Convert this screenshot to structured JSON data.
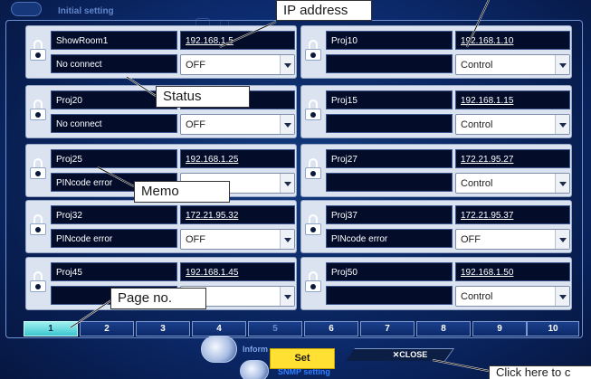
{
  "window": {
    "title": "Initial setting"
  },
  "projectors": [
    {
      "name": "ShowRoom1",
      "ip": "192.168.1.5",
      "status": "No connect",
      "mode": "OFF"
    },
    {
      "name": "Proj10",
      "ip": "192.168.1.10",
      "status": "",
      "mode": "Control"
    },
    {
      "name": "Proj20",
      "ip": "",
      "status": "No connect",
      "mode": "OFF"
    },
    {
      "name": "Proj15",
      "ip": "192.168.1.15",
      "status": "",
      "mode": "Control"
    },
    {
      "name": "Proj25",
      "ip": "192.168.1.25",
      "status": "PINcode error",
      "mode": ""
    },
    {
      "name": "Proj27",
      "ip": "172.21.95.27",
      "status": "",
      "mode": "Control"
    },
    {
      "name": "Proj32",
      "ip": "172.21.95.32",
      "status": "PINcode error",
      "mode": "OFF"
    },
    {
      "name": "Proj37",
      "ip": "172.21.95.37",
      "status": "PINcode error",
      "mode": "OFF"
    },
    {
      "name": "Proj45",
      "ip": "192.168.1.45",
      "status": "",
      "mode": "ol"
    },
    {
      "name": "Proj50",
      "ip": "192.168.1.50",
      "status": "",
      "mode": "Control"
    }
  ],
  "pagination": {
    "pages": [
      "1",
      "2",
      "3",
      "4",
      "5",
      "6",
      "7",
      "8",
      "9",
      "10"
    ],
    "current": "1"
  },
  "footer": {
    "info_label": "Inform",
    "set_label": "Set",
    "snmp_label": "SNMP setting",
    "close_label": "✕CLOSE"
  },
  "callouts": {
    "ip_address": "IP address",
    "status": "Status",
    "memo": "Memo",
    "page_no": "Page no.",
    "close_hint": "Click here to c"
  },
  "colors": {
    "accent_yellow": "#ffe033",
    "active_page": "#3cc6cf",
    "background": "#0c2b6e"
  }
}
